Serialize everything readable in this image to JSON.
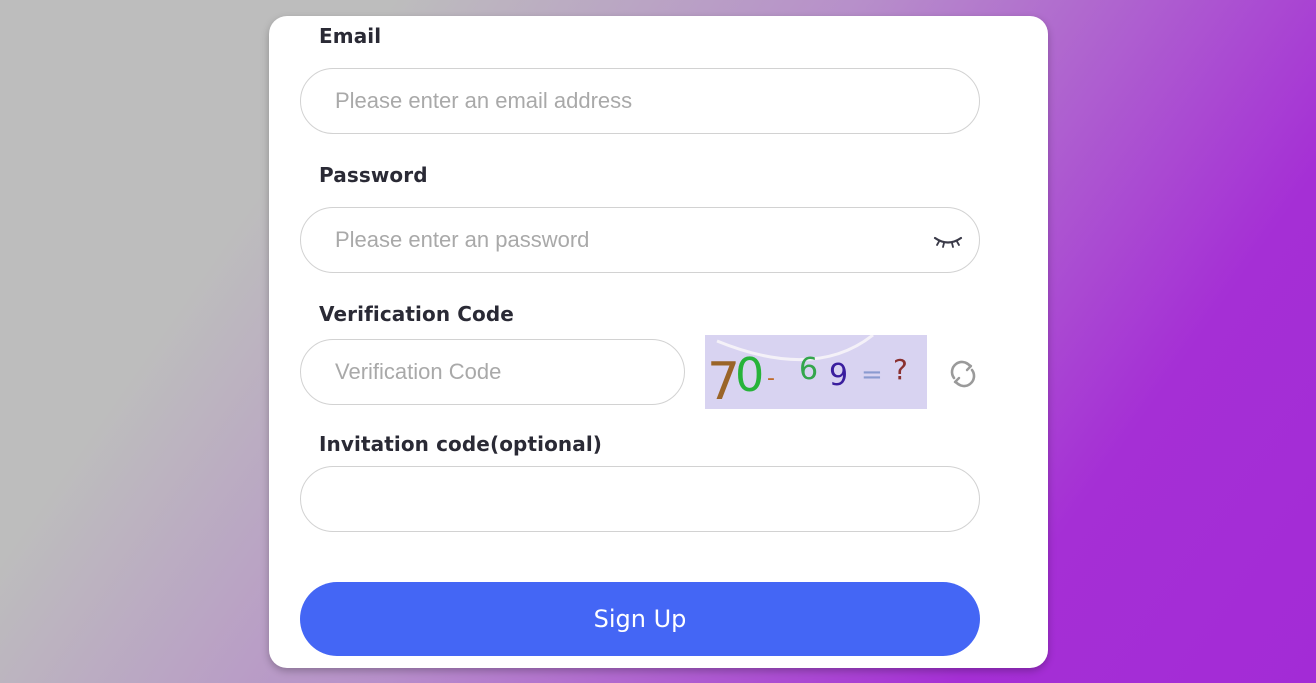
{
  "form": {
    "email": {
      "label": "Email",
      "placeholder": "Please enter an email address",
      "value": ""
    },
    "password": {
      "label": "Password",
      "placeholder": "Please enter an password",
      "value": ""
    },
    "verification": {
      "label": "Verification Code",
      "placeholder": "Verification Code",
      "value": "",
      "captcha": {
        "chars": [
          "7",
          "0",
          "-",
          "6",
          "9",
          "=",
          "?"
        ],
        "colors": [
          "#9a6428",
          "#27b33a",
          "#c06a2a",
          "#33a64c",
          "#3a1e9e",
          "#8a9ad0",
          "#8a3030"
        ],
        "background": "#d8d3f1"
      }
    },
    "invitation": {
      "label": "Invitation code(optional)",
      "placeholder": "",
      "value": ""
    },
    "submit_label": "Sign Up"
  },
  "icons": {
    "password_toggle": "eye-closed-icon",
    "captcha_refresh": "refresh-icon"
  },
  "colors": {
    "primary": "#4466f5",
    "label_text": "#2a2a35",
    "placeholder": "#a9a9a9",
    "card_bg": "#ffffff"
  }
}
